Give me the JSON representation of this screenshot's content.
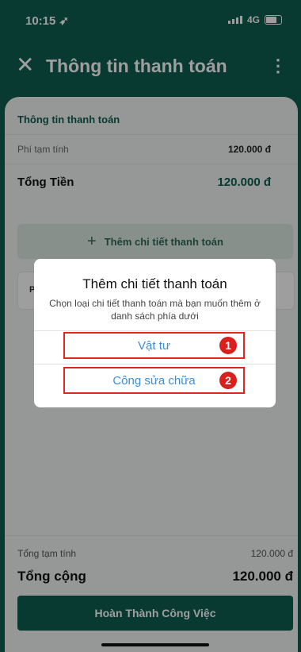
{
  "status_bar": {
    "time": "10:15",
    "network": "4G"
  },
  "app_bar": {
    "title": "Thông tin thanh toán"
  },
  "payment_info": {
    "section_title": "Thông tin thanh toán",
    "estimated_fee_label": "Phí tạm tính",
    "estimated_fee_value": "120.000 đ",
    "total_label": "Tổng Tiền",
    "total_value": "120.000 đ",
    "add_detail_label": "Thêm chi tiết thanh toán"
  },
  "card_partial": {
    "label": "P"
  },
  "footer": {
    "subtotal_label": "Tổng tạm tính",
    "subtotal_value": "120.000 đ",
    "total_label": "Tổng cộng",
    "total_value": "120.000 đ",
    "complete_button": "Hoàn Thành Công Việc"
  },
  "dialog": {
    "title": "Thêm chi tiết thanh toán",
    "message": "Chọn loại chi tiết thanh toán mà bạn muốn thêm ở danh sách phía dưới",
    "options": [
      {
        "label": "Vật tư",
        "badge": "1"
      },
      {
        "label": "Công sửa chữa",
        "badge": "2"
      }
    ]
  },
  "colors": {
    "brand": "#0f5e4f",
    "option_text": "#3a8fd6",
    "highlight": "#e0261e"
  }
}
